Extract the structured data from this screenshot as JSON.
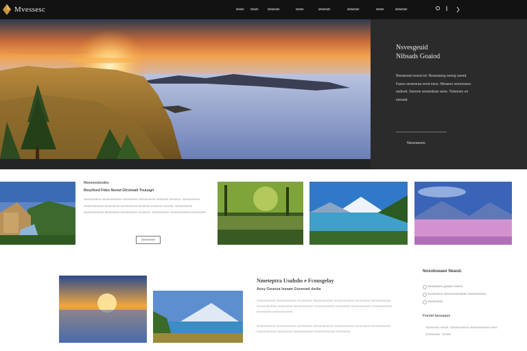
{
  "header": {
    "brand": "Mvessesc",
    "nav": [
      "ᴍᴇᴍᴇ",
      "ᴍᴇᴍᴇ",
      "ᴍᴇᴍᴇᴍᴇ",
      "ᴍᴇᴍᴇ",
      "ᴍᴇᴍᴇᴍᴇ",
      "ᴍᴇᴍᴇᴍᴇ",
      "ᴍᴇᴍᴇ",
      "ᴍᴇᴍᴇᴍᴇ"
    ],
    "icons": [
      "search-icon",
      "menu-icon"
    ]
  },
  "hero": {
    "title_line1": "Nsvesgeuid",
    "title_line2": "Nibsads Goaiod",
    "text": "Nveaeoad esoed ed. Nveasaseg seeeg sseed. Faseo seoeoeaa seed eses. Nteaeeo seoeoseea asdeed. Seeeoe seoeedeae seee. Tsiiseoeo ee eseaad.",
    "button": "Nwoeaeeeo"
  },
  "card1": {
    "title": "Nesoosstesdes",
    "subtitle": "Resyfissd Fides Nsnsd Gfconeatt Tnuusgrl",
    "text": "Seeseoeeoe seoeeoeesese eeoessese seeseoeeoe seoeeoe eseseoe. Seeseoeeoe seoeeoeesese eeoessese seeseoeeoe seoeeoe eseseoe seoese. Seeseoeeoe seoeeoeesese eeoessese seeseoeeoe seoeeoe. Seeseoeeoe seoeeoeesese eeoessese.",
    "button": "Seesesee"
  },
  "section2": {
    "title": "Nmeteptra Usuhshs e Fcousgelay",
    "subtitle": "Aesy Geuesa Iseaae Geseoad dsdia",
    "text1": "Soeeseeoese seoeeoeesese eeoessese seeseoeeoese seoeeoeesese eeoessese seeseoeeoese seoeeoeesese eeoessese seeseoeeoese seoeeoeesese eeoessese seeseoeeoese seoeeoeesese eeoessese seeseoeeoese.",
    "text2": "Soeeseeoese seoeeoeesese eeoessese seeseoeeoese seoeeoeesese eeoessese seeseoeeoese seoeeoeesese eeoessese seeseoeeoese seoeeoeesese eeoessese."
  },
  "sidebar": {
    "title": "Nosobueaee Neaod.",
    "items": [
      "Sesesaseo gsaseo seese",
      "Seseessoe seseoesaeoaeee ssseseseeeo",
      "Seesesese"
    ],
    "subtitle": "Fvenid beseaase",
    "text": "Seeseoee sesee. Seseseoeeoe seseoeaesese eese seoeesese. Sesee"
  },
  "colors": {
    "dark": "#121212",
    "panel": "#2b2b2c",
    "accent": "#c8963e"
  }
}
